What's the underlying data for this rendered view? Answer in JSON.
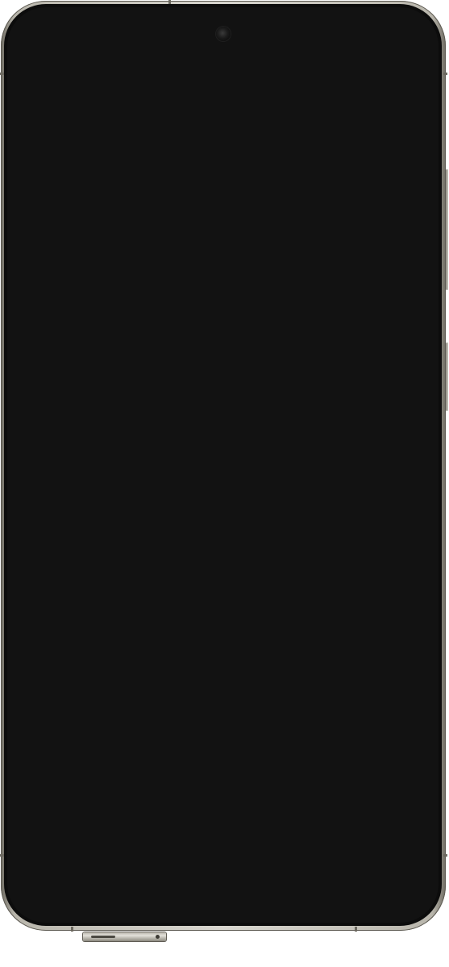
{
  "device": {
    "type": "smartphone",
    "screen_state": "off",
    "screen_color": "#121212",
    "frame_color": "#c9c6bd",
    "icons": {
      "camera": "front-camera-icon"
    }
  }
}
